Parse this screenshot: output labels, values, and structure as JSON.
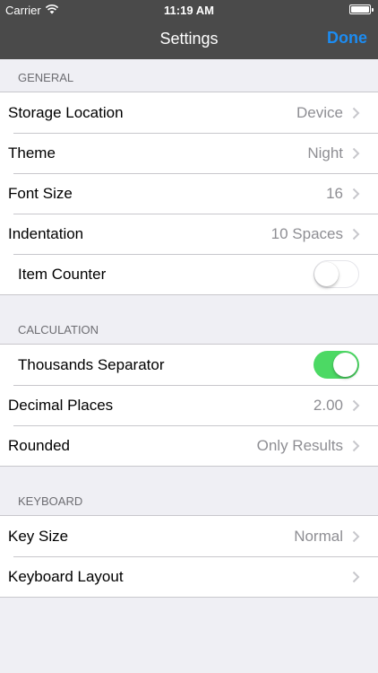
{
  "status_bar": {
    "carrier": "Carrier",
    "time": "11:19 AM",
    "battery_level": 1.0
  },
  "nav": {
    "title": "Settings",
    "done_label": "Done",
    "accent_color": "#1c8cf2"
  },
  "general": {
    "header": "GENERAL",
    "storage_location": {
      "label": "Storage Location",
      "value": "Device"
    },
    "theme": {
      "label": "Theme",
      "value": "Night"
    },
    "font_size": {
      "label": "Font Size",
      "value": "16"
    },
    "indentation": {
      "label": "Indentation",
      "value": "10 Spaces"
    },
    "item_counter": {
      "label": "Item Counter",
      "on": false
    }
  },
  "calculation": {
    "header": "CALCULATION",
    "thousands_separator": {
      "label": "Thousands Separator",
      "on": true
    },
    "decimal_places": {
      "label": "Decimal Places",
      "value": "2.00"
    },
    "rounded": {
      "label": "Rounded",
      "value": "Only Results"
    }
  },
  "keyboard": {
    "header": "KEYBOARD",
    "key_size": {
      "label": "Key Size",
      "value": "Normal"
    },
    "keyboard_layout": {
      "label": "Keyboard Layout",
      "value": ""
    }
  },
  "colors": {
    "toggle_on": "#4cd964",
    "nav_background": "#4a4a4a",
    "page_background": "#efeff4"
  }
}
